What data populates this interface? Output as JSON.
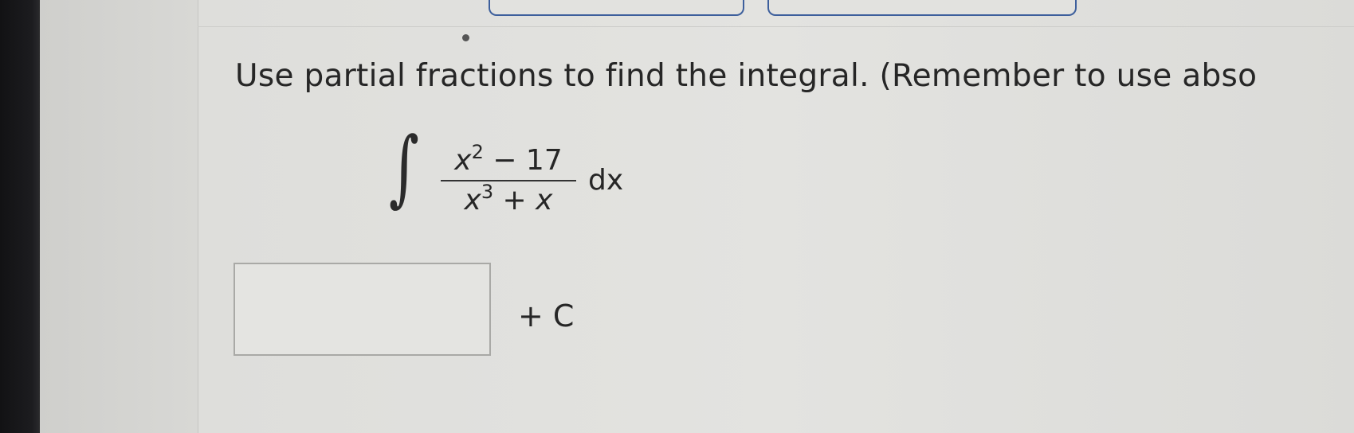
{
  "question": {
    "text": "Use partial fractions to find the integral. (Remember to use abso"
  },
  "integral": {
    "sign": "∫",
    "numerator": {
      "base": "x",
      "exponent": "2",
      "rest": " − 17"
    },
    "denominator": {
      "base": "x",
      "exponent": "3",
      "rest": " + ",
      "tail": "x"
    },
    "differential": "dx"
  },
  "answer": {
    "value": "",
    "suffix": "+ C"
  },
  "colors": {
    "tab_border": "#3d5f9c",
    "text": "#262626",
    "input_border": "#a9a9a6"
  }
}
